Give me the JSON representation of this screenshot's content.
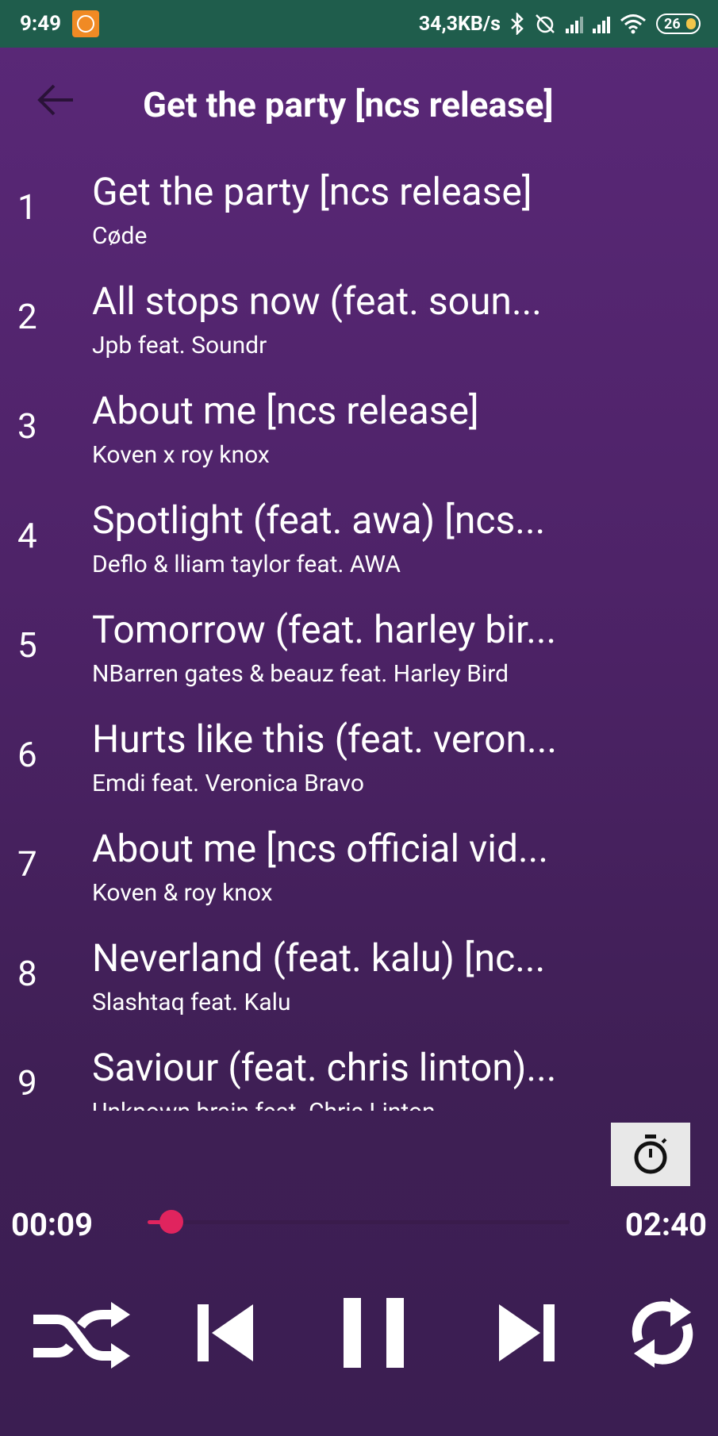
{
  "status_bar": {
    "time": "9:49",
    "speed": "34,3KB/s",
    "battery": "26"
  },
  "header": {
    "title": "Get the party [ncs release]"
  },
  "tracks": [
    {
      "num": "1",
      "title": "Get the party [ncs release]",
      "artist": "Cøde"
    },
    {
      "num": "2",
      "title": "All stops now (feat. soun...",
      "artist": "Jpb feat. Soundr"
    },
    {
      "num": "3",
      "title": "About me [ncs release]",
      "artist": "Koven x roy knox"
    },
    {
      "num": "4",
      "title": "Spotlight (feat. awa) [ncs...",
      "artist": "Deflo & lliam taylor feat. AWA"
    },
    {
      "num": "5",
      "title": "Tomorrow (feat. harley bir...",
      "artist": "NBarren gates & beauz feat. Harley Bird"
    },
    {
      "num": "6",
      "title": "Hurts like this (feat. veron...",
      "artist": "Emdi feat. Veronica Bravo"
    },
    {
      "num": "7",
      "title": "About me [ncs official vid...",
      "artist": "Koven & roy knox"
    },
    {
      "num": "8",
      "title": "Neverland (feat. kalu) [nc...",
      "artist": "Slashtaq feat. Kalu"
    },
    {
      "num": "9",
      "title": "Saviour (feat. chris linton)...",
      "artist": "Unknown brain feat. Chris Linton"
    }
  ],
  "player": {
    "elapsed": "00:09",
    "total": "02:40",
    "progress": 0.0563,
    "accent_color": "#e0245e"
  },
  "icons": {
    "back": "arrow-left-icon",
    "timer": "stopwatch-icon",
    "shuffle": "shuffle-icon",
    "previous": "skip-previous-icon",
    "pause": "pause-icon",
    "next": "skip-next-icon",
    "repeat": "repeat-icon"
  }
}
